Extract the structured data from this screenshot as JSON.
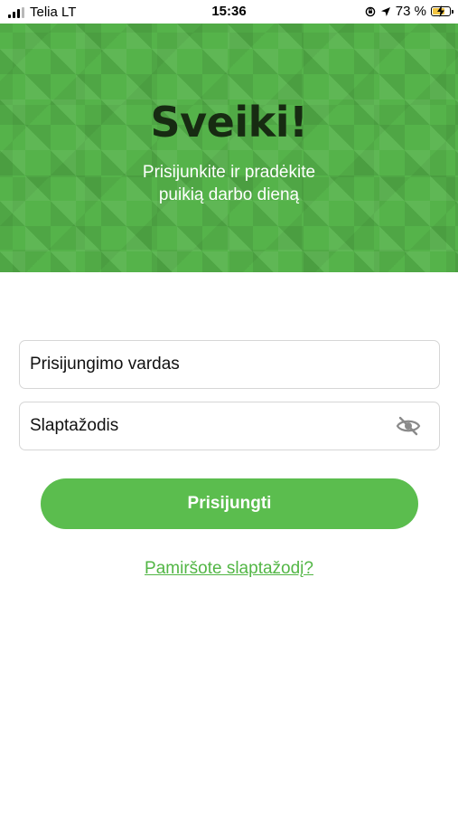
{
  "status_bar": {
    "carrier": "Telia LT",
    "time": "15:36",
    "battery_percent": "73 %",
    "battery_level": 0.73,
    "icons": [
      "signal-icon",
      "rotation-lock-icon",
      "location-arrow-icon",
      "battery-charging-icon"
    ]
  },
  "hero": {
    "title": "Sveiki!",
    "subtitle_line1": "Prisijunkite ir pradėkite",
    "subtitle_line2": "puikią darbo dieną"
  },
  "form": {
    "username_placeholder": "Prisijungimo vardas",
    "password_placeholder": "Slaptažodis",
    "login_label": "Prisijungti",
    "forgot_label": "Pamiršote slaptažodį?"
  },
  "colors": {
    "accent": "#5bbd4e",
    "hero_bg": "#55b34a",
    "title": "#172b12",
    "link": "#52b645"
  }
}
